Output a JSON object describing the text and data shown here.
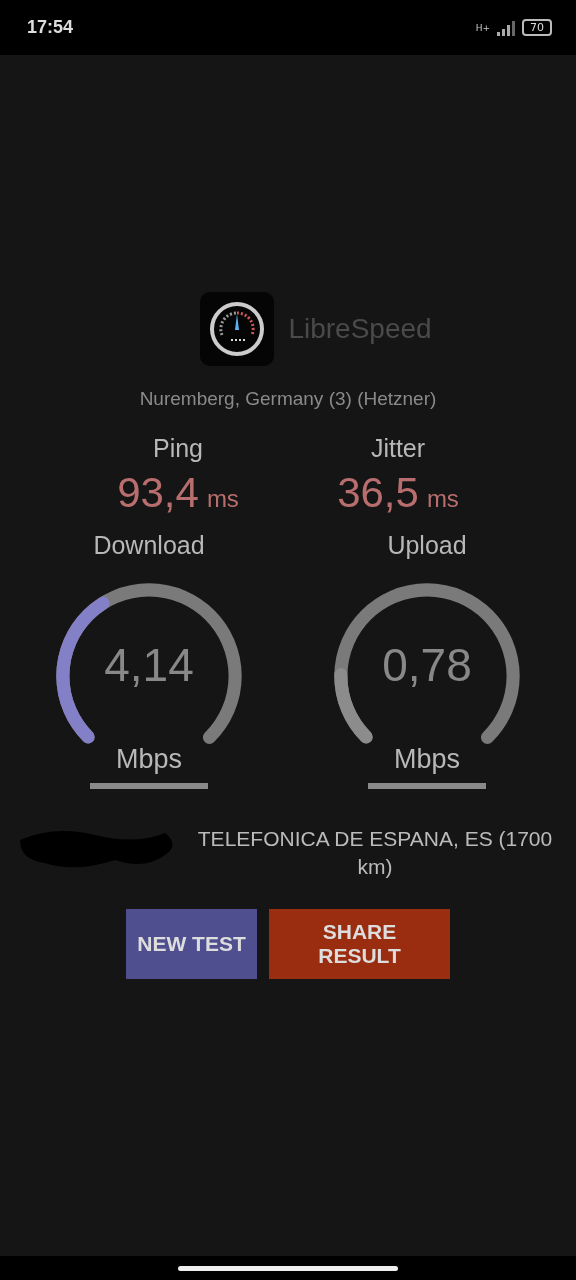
{
  "status_bar": {
    "time": "17:54",
    "network": "H+",
    "battery": "70"
  },
  "app": {
    "title": "LibreSpeed"
  },
  "server": "Nuremberg, Germany (3) (Hetzner)",
  "stats": [
    {
      "label": "Ping",
      "value": "93,4",
      "unit": "ms"
    },
    {
      "label": "Jitter",
      "value": "36,5",
      "unit": "ms"
    }
  ],
  "gauges": [
    {
      "label": "Download",
      "value": "4,14",
      "unit": "Mbps",
      "level": 0.38,
      "color": "#8480c8"
    },
    {
      "label": "Upload",
      "value": "0,78",
      "unit": "Mbps",
      "level": 0.17,
      "color": "#8c8c8c"
    }
  ],
  "ip_info": "TELEFONICA DE ESPANA, ES (1700 km)",
  "buttons": [
    {
      "label": "NEW TEST",
      "kind": "primary"
    },
    {
      "label": "SHARE RESULT",
      "kind": "share"
    }
  ]
}
